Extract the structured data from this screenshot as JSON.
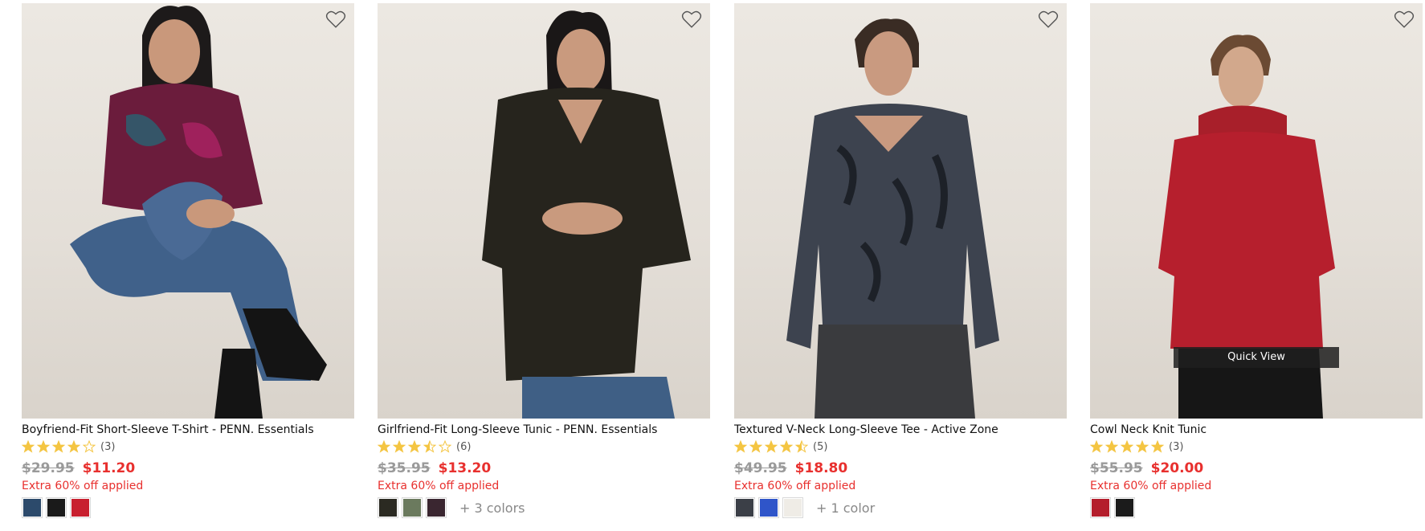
{
  "products": [
    {
      "title": "Boyfriend-Fit Short-Sleeve T-Shirt - PENN. Essentials",
      "rating": 4,
      "rating_count": "(3)",
      "price_was": "$29.95",
      "price_now": "$11.20",
      "promo": "Extra 60% off applied",
      "swatch_colors": [
        "#2c4a6b",
        "#1a1a1a",
        "#c8202f"
      ],
      "more_colors": "",
      "quick_view": ""
    },
    {
      "title": "Girlfriend-Fit Long-Sleeve Tunic - PENN. Essentials",
      "rating": 3.5,
      "rating_count": "(6)",
      "price_was": "$35.95",
      "price_now": "$13.20",
      "promo": "Extra 60% off applied",
      "swatch_colors": [
        "#2b2a22",
        "#6b7a5e",
        "#3a2630"
      ],
      "more_colors": "+ 3 colors",
      "quick_view": ""
    },
    {
      "title": "Textured V-Neck Long-Sleeve Tee - Active Zone",
      "rating": 4.5,
      "rating_count": "(5)",
      "price_was": "$49.95",
      "price_now": "$18.80",
      "promo": "Extra 60% off applied",
      "swatch_colors": [
        "#3b3f47",
        "#2f55c9",
        "#efece6"
      ],
      "more_colors": "+ 1 color",
      "quick_view": ""
    },
    {
      "title": "Cowl Neck Knit Tunic",
      "rating": 5,
      "rating_count": "(3)",
      "price_was": "$55.95",
      "price_now": "$20.00",
      "promo": "Extra 60% off applied",
      "swatch_colors": [
        "#b41e2c",
        "#1b1b1b"
      ],
      "more_colors": "",
      "quick_view": "Quick View"
    }
  ],
  "colors": {
    "sale_red": "#e8302e",
    "star_gold": "#f4c542",
    "strike_grey": "#9a9a9a"
  }
}
